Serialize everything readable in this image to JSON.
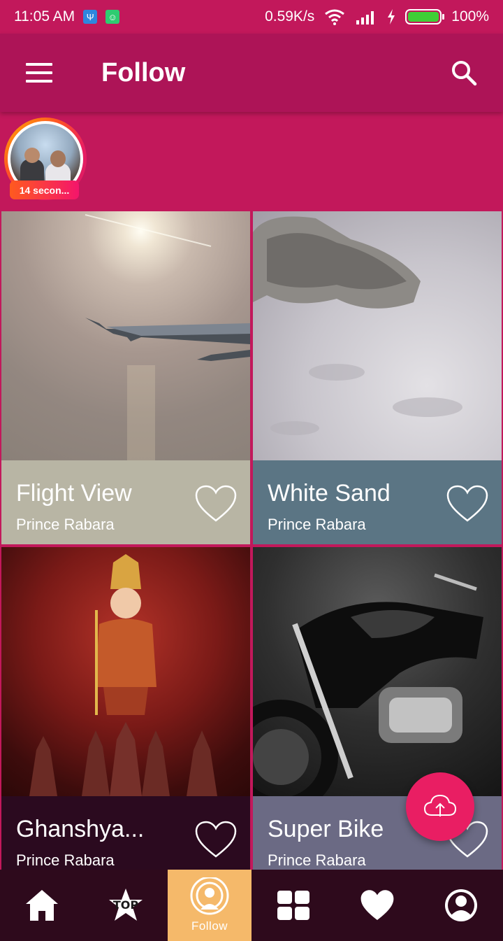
{
  "status_bar": {
    "time": "11:05 AM",
    "network_speed": "0.59K/s",
    "battery_percent": "100%",
    "battery_level": 1.0,
    "icons": [
      "usb-icon",
      "android-icon",
      "wifi-icon",
      "signal-icon",
      "charging-icon",
      "battery-icon"
    ]
  },
  "app_bar": {
    "title": "Follow",
    "menu_icon": "hamburger-menu-icon",
    "search_icon": "search-icon"
  },
  "stories": [
    {
      "time_label": "14 secon..."
    }
  ],
  "cards": [
    {
      "title": "Flight View",
      "author": "Prince Rabara",
      "footer_color": "#b8b5a4"
    },
    {
      "title": "White Sand",
      "author": "Prince Rabara",
      "footer_color": "#5b7584"
    },
    {
      "title": "Ghanshya...",
      "author": "Prince Rabara",
      "footer_color": "#2b0a1f"
    },
    {
      "title": "Super Bike",
      "author": "Prince Rabara",
      "footer_color": "#6b6a84"
    }
  ],
  "fab": {
    "icon": "cloud-upload-icon"
  },
  "bottom_nav": [
    {
      "icon": "home-icon"
    },
    {
      "icon": "top-star-icon",
      "badge_text": "TOP"
    },
    {
      "icon": "follow-broadcast-icon",
      "label": "Follow",
      "active": true
    },
    {
      "icon": "grid-icon"
    },
    {
      "icon": "heart-icon"
    },
    {
      "icon": "profile-icon"
    }
  ],
  "colors": {
    "primary": "#c2185b",
    "primary_dark": "#ad1457",
    "accent": "#e91e63",
    "nav_background": "#2e0a1c",
    "nav_active": "#f5b96a"
  }
}
